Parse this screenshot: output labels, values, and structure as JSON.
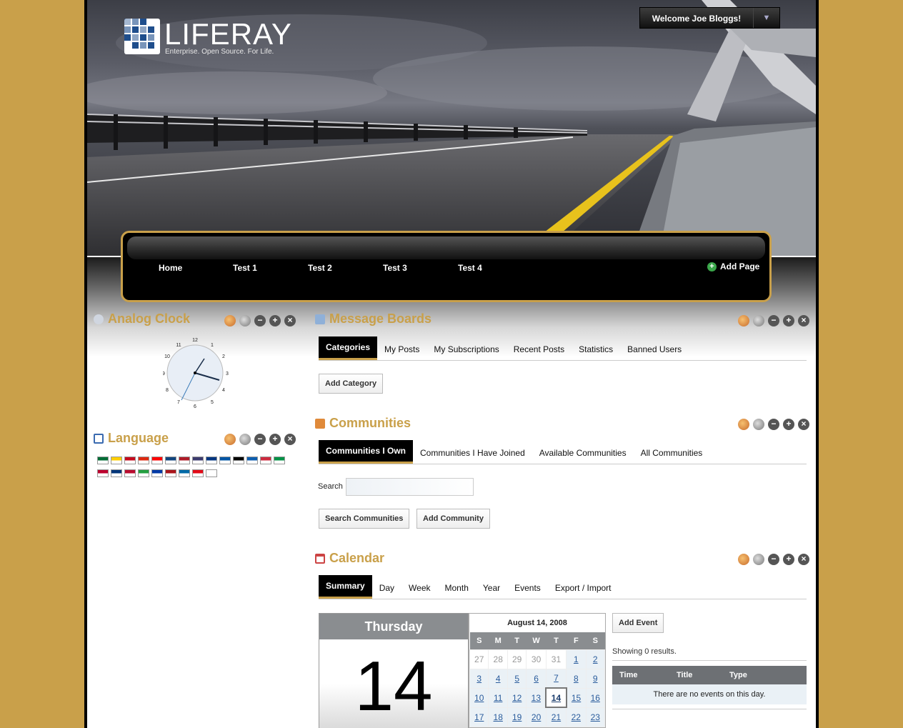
{
  "brand": {
    "name": "LIFERAY",
    "tagline": "Enterprise. Open Source. For Life."
  },
  "user": {
    "welcome": "Welcome Joe Bloggs!"
  },
  "nav": {
    "items": [
      "Home",
      "Test 1",
      "Test 2",
      "Test 3",
      "Test 4"
    ],
    "add_page": "Add Page"
  },
  "clock": {
    "title": "Analog Clock",
    "numbers": [
      "12",
      "1",
      "2",
      "3",
      "4",
      "5",
      "6",
      "7",
      "8",
      "9",
      "10",
      "11"
    ]
  },
  "language": {
    "title": "Language",
    "flags": [
      [
        "#006c35",
        "#ffce00",
        "#c60b1e",
        "#de2910",
        "#fe0000",
        "#11457e",
        "#ae1c28",
        "#3c3b6e",
        "#003580",
        "#0055a4",
        "#000000",
        "#0d5eaf",
        "#cd2a3e",
        "#009246"
      ],
      [
        "#bc002d",
        "#003478",
        "#ba0c2f",
        "#239f40",
        "#0039a6",
        "#aa151b",
        "#006aa7",
        "#e30a17",
        "#ffffff"
      ]
    ]
  },
  "message_boards": {
    "title": "Message Boards",
    "tabs": [
      "Categories",
      "My Posts",
      "My Subscriptions",
      "Recent Posts",
      "Statistics",
      "Banned Users"
    ],
    "add_category": "Add Category"
  },
  "communities": {
    "title": "Communities",
    "tabs": [
      "Communities I Own",
      "Communities I Have Joined",
      "Available Communities",
      "All Communities"
    ],
    "search_label": "Search",
    "search_value": "",
    "search_button": "Search Communities",
    "add_button": "Add Community"
  },
  "calendar": {
    "title": "Calendar",
    "tabs": [
      "Summary",
      "Day",
      "Week",
      "Month",
      "Year",
      "Events",
      "Export / Import"
    ],
    "day_name": "Thursday",
    "day_number": "14",
    "month_title": "August 14, 2008",
    "weekdays": [
      "S",
      "M",
      "T",
      "W",
      "T",
      "F",
      "S"
    ],
    "weeks": [
      [
        "27",
        "28",
        "29",
        "30",
        "31",
        "1",
        "2"
      ],
      [
        "3",
        "4",
        "5",
        "6",
        "7",
        "8",
        "9"
      ],
      [
        "10",
        "11",
        "12",
        "13",
        "14",
        "15",
        "16"
      ],
      [
        "17",
        "18",
        "19",
        "20",
        "21",
        "22",
        "23"
      ]
    ],
    "add_event": "Add Event",
    "showing": "Showing 0 results.",
    "columns": [
      "Time",
      "Title",
      "Type"
    ],
    "empty": "There are no events on this day."
  },
  "colors": {
    "accent": "#c9a04a",
    "background": "#c9a04a",
    "table_header": "#8a8d90"
  },
  "icons": {
    "portlet_controls": [
      "look-and-feel-icon",
      "configuration-icon",
      "minimize-icon",
      "maximize-icon",
      "close-icon"
    ]
  }
}
